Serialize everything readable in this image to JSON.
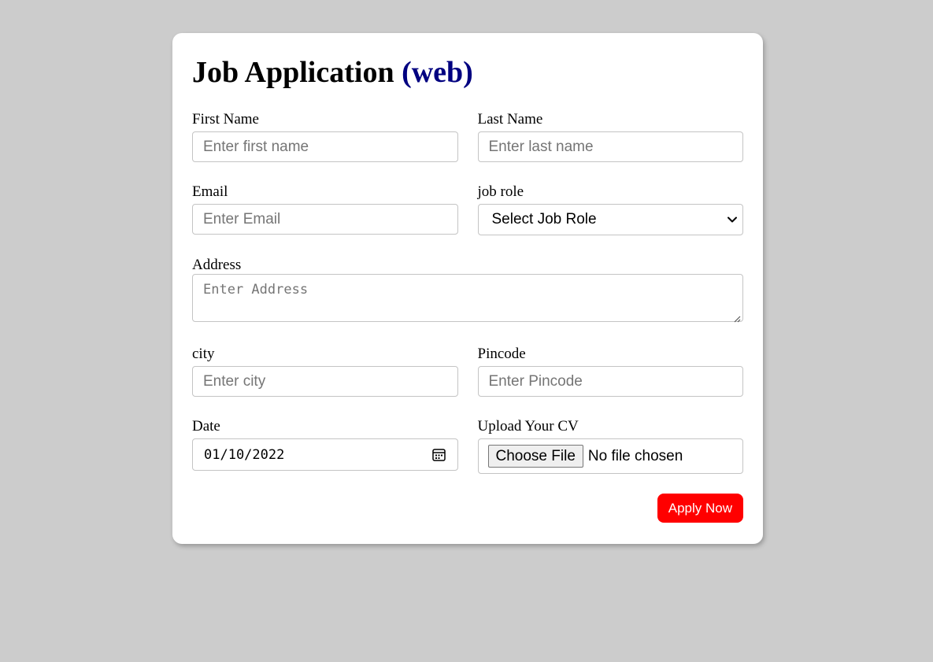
{
  "form": {
    "title_main": "Job Application",
    "title_accent": "(web)",
    "accent_color": "#000080",
    "fields": {
      "first_name": {
        "label": "First Name",
        "placeholder": "Enter first name"
      },
      "last_name": {
        "label": "Last Name",
        "placeholder": "Enter last name"
      },
      "email": {
        "label": "Email",
        "placeholder": "Enter Email"
      },
      "job_role": {
        "label": "job role",
        "selected": "Select Job Role",
        "icon": "chevron-down-icon"
      },
      "address": {
        "label": "Address",
        "placeholder": "Enter Address"
      },
      "city": {
        "label": "city",
        "placeholder": "Enter city"
      },
      "pincode": {
        "label": "Pincode",
        "placeholder": "Enter Pincode"
      },
      "date": {
        "label": "Date",
        "value": "01/10/2022",
        "icon": "calendar-icon"
      },
      "cv": {
        "label": "Upload Your CV",
        "button_label": "Choose File",
        "status": "No file chosen"
      }
    },
    "submit": {
      "label": "Apply Now",
      "color": "#ff0000"
    }
  },
  "page": {
    "background_color": "#cccccc",
    "card_color": "#ffffff"
  }
}
